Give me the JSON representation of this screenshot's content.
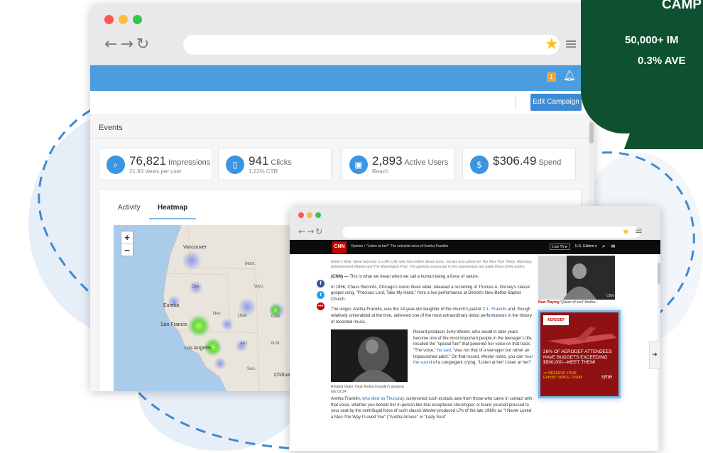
{
  "campaign_badge": {
    "title": "CAMP",
    "line1": "50,000+ IM",
    "line2": "0.3% AVE",
    "color": "#0d5131"
  },
  "dashboard": {
    "toolbar": {
      "edit_campaign_label": "Edit Campaign",
      "notification_count": "1",
      "accent": "#4a9ee0"
    },
    "events_label": "Events",
    "stats": [
      {
        "icon": "search-icon",
        "value": "76,821",
        "label": "Impressions",
        "sub": "21.93 views per user"
      },
      {
        "icon": "mouse-icon",
        "value": "941",
        "label": "Clicks",
        "sub": "1.22% CTR"
      },
      {
        "icon": "user-card-icon",
        "value": "2,893",
        "label": "Active Users",
        "sub": "Reach"
      },
      {
        "icon": "dollar-icon",
        "value": "$306.49",
        "label": "Spend",
        "sub": ""
      }
    ],
    "tabs": [
      {
        "label": "Activity",
        "active": false
      },
      {
        "label": "Heatmap",
        "active": true
      }
    ],
    "map": {
      "zoom_in": "+",
      "zoom_out": "−",
      "labels": {
        "vancouver": "Vancouver",
        "mont": "Mont.",
        "ore": "Ore.",
        "wyo": "Wyo.",
        "eureka": "Eureka",
        "nev": "Nev.",
        "utah": "Utah",
        "colo": "Colo.",
        "sanfrancisco": "San Francis",
        "losangeles": "Los Angeles",
        "ariz": "Ariz.",
        "nm": "N.M.",
        "son": "Son.",
        "chihuahua": "Chihua"
      }
    }
  },
  "cnn": {
    "logo": "CNN",
    "header_title": "Opinion • \"Listen at her!\" The celestial voice of Aretha Franklin",
    "live_tv": "Live TV ▸",
    "edition": "U.S. Edition ▾",
    "editors_note": "Editor's Note: Gene Seymour is a film critic who has written about music, movies and culture for The New York Times, Newsday, Entertainment Weekly and The Washington Post. The opinions expressed in this commentary are solely those of the author.",
    "p1_lead": "(CNN) —",
    "p1_rest": " This is what we mean when we call a human being a force of nature:",
    "p2": "In 1956, Chess Records, Chicago's iconic blues label, released a recording of Thomas A. Dorsey's classic gospel song, \"Precious Lord, Take My Hand,\" from a live performance at Detroit's New Bethel Baptist Church.",
    "p3_a": "The singer, Aretha Franklin, was the 14-year-old daughter of the church's pastor ",
    "p3_link": "C.L. Franklin",
    "p3_b": " and, though relatively unheralded at the time, delivered one of the most extraordinary debut performances in the history of recorded music.",
    "p4_a": "Record producer Jerry Wexler, who would in later years become one of the most important people in the teenager's life, recalled the \"special fuel\" that powered her voice on that track. \"The voice,\" ",
    "p4_link1": "he said",
    "p4_b": ", \"was not that of a teenager but rather an impassioned adult.\" On that record, Wexler notes, you can ",
    "p4_link2": "hear the sound",
    "p4_c": " of a congregant crying, \"Listen at her! Listen at her!\"",
    "related": "Related Video: Hear Aretha Franklin's greatest hits 02:24",
    "p5_a": "Aretha Franklin, ",
    "p5_link": "who died on Thursday",
    "p5_b": ", summoned such ecstatic awe from those who came in contact with that voice, whether you beheld her in person like that enraptured churchgoer or found yourself pressed to your seat by the centrifugal force of such classic Wexler-produced LPs of the late 1960s as \"I Never Loved a Man The Way I Loved You\" (\"Aretha Arrives\" or \"Lady Soul\"",
    "now_playing_label": "Now Playing",
    "now_playing_title": "'Queen of soul' Aretha...",
    "photo_credit": "CNN",
    "ad": {
      "logo": "AERODEF",
      "line1": "26% OF AERODEF ATTENDEES",
      "line2": "HAVE BUDGETS EXCEEDING",
      "line3": "$500,000—MEET THEM!",
      "cta1": ">> RESERVE YOUR",
      "cta2": "EXHIBIT SPACE TODAY",
      "brand": "sme"
    }
  }
}
